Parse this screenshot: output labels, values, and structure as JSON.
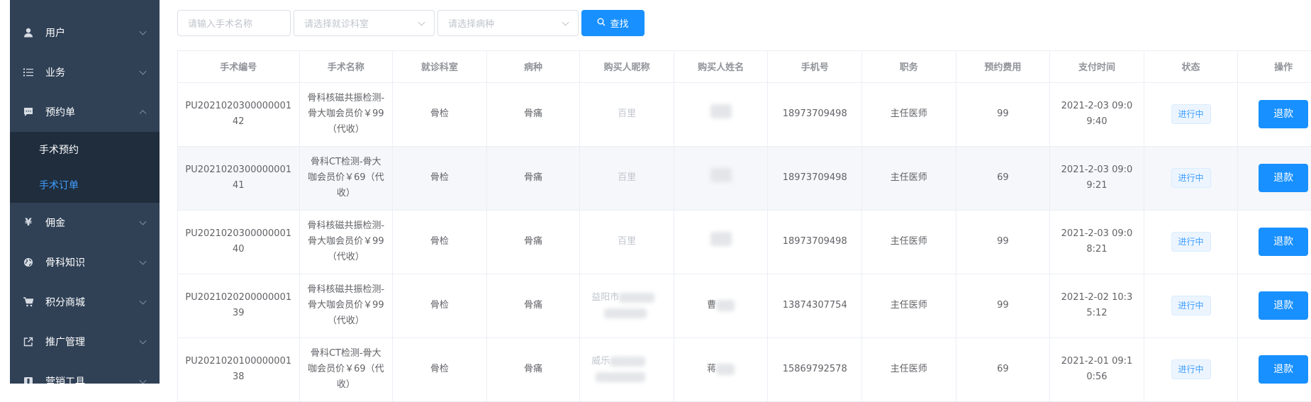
{
  "sidebar": {
    "items": [
      {
        "label": "用户",
        "icon": "user-icon"
      },
      {
        "label": "业务",
        "icon": "list-icon"
      },
      {
        "label": "预约单",
        "icon": "chat-icon",
        "expanded": true,
        "children": [
          {
            "label": "手术预约"
          },
          {
            "label": "手术订单",
            "active": true
          }
        ]
      },
      {
        "label": "佣金",
        "icon": "yen-icon"
      },
      {
        "label": "骨科知识",
        "icon": "globe-icon"
      },
      {
        "label": "积分商城",
        "icon": "cart-icon"
      },
      {
        "label": "推广管理",
        "icon": "external-link-icon"
      },
      {
        "label": "营销工具",
        "icon": "tool-icon"
      }
    ]
  },
  "search": {
    "name_placeholder": "请输入手术名称",
    "dept_placeholder": "请选择就诊科室",
    "disease_placeholder": "请选择病种",
    "button_label": "查找"
  },
  "table": {
    "headers": [
      "手术编号",
      "手术名称",
      "就诊科室",
      "病种",
      "购买人昵称",
      "购买人姓名",
      "手机号",
      "职务",
      "预约费用",
      "支付时间",
      "状态",
      "操作"
    ],
    "rows": [
      {
        "id": "PU202102030000000142",
        "name": "骨科核磁共振检测-骨大咖会员价￥99（代收）",
        "dept": "骨检",
        "disease": "骨痛",
        "nickname": "百里",
        "buyer": "",
        "phone": "18973709498",
        "title": "主任医师",
        "fee": "99",
        "paid_at": "2021-2-03 09:09:40",
        "status": "进行中",
        "action": "退款"
      },
      {
        "id": "PU202102030000000141",
        "name": "骨科CT检测-骨大咖会员价￥69（代收）",
        "dept": "骨检",
        "disease": "骨痛",
        "nickname": "百里",
        "buyer": "",
        "phone": "18973709498",
        "title": "主任医师",
        "fee": "69",
        "paid_at": "2021-2-03 09:09:21",
        "status": "进行中",
        "action": "退款"
      },
      {
        "id": "PU202102030000000140",
        "name": "骨科核磁共振检测-骨大咖会员价￥99（代收）",
        "dept": "骨检",
        "disease": "骨痛",
        "nickname": "百里",
        "buyer": "",
        "phone": "18973709498",
        "title": "主任医师",
        "fee": "99",
        "paid_at": "2021-2-03 09:08:21",
        "status": "进行中",
        "action": "退款"
      },
      {
        "id": "PU202102020000000139",
        "name": "骨科核磁共振检测-骨大咖会员价￥99（代收）",
        "dept": "骨检",
        "disease": "骨痛",
        "nickname": "益阳市",
        "buyer": "曹",
        "phone": "13874307754",
        "title": "主任医师",
        "fee": "99",
        "paid_at": "2021-2-02 10:35:12",
        "status": "进行中",
        "action": "退款"
      },
      {
        "id": "PU202102010000000138",
        "name": "骨科CT检测-骨大咖会员价￥69（代收）",
        "dept": "骨检",
        "disease": "骨痛",
        "nickname": "威乐",
        "buyer": "蒋",
        "phone": "15869792578",
        "title": "主任医师",
        "fee": "69",
        "paid_at": "2021-2-01 09:10:56",
        "status": "进行中",
        "action": "退款"
      }
    ]
  }
}
